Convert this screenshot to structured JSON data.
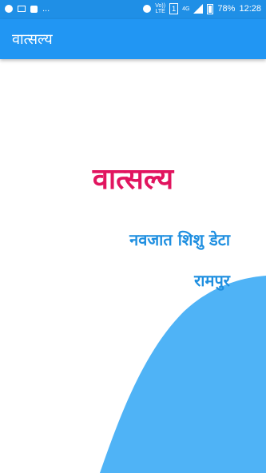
{
  "status_bar": {
    "notification_dots": "...",
    "network_label_1": "Vo))",
    "network_label_2": "LTE",
    "sim_label": "1",
    "net_4g": "4G",
    "battery_percent": "78%",
    "time": "12:28"
  },
  "appbar": {
    "title": "वात्सल्य"
  },
  "main": {
    "title": "वात्सल्य",
    "subtitle": "नवजात शिशु डेटा",
    "place": "रामपुर"
  },
  "colors": {
    "statusbar": "#1f8fe6",
    "appbar": "#2196f3",
    "title": "#e1155f",
    "subtitle": "#1f8fe0",
    "wave": "#4fb3f6"
  }
}
